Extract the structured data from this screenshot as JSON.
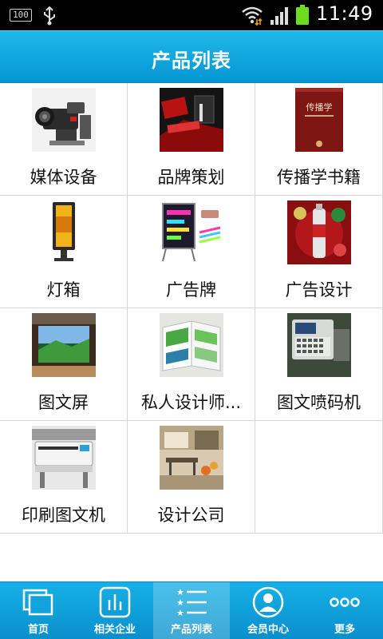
{
  "status_bar": {
    "battery_small_text": "100",
    "time": "11:49"
  },
  "header": {
    "title": "产品列表"
  },
  "products": [
    {
      "label": "媒体设备",
      "icon": "camera-thumbnail"
    },
    {
      "label": "品牌策划",
      "icon": "brand-thumbnail"
    },
    {
      "label": "传播学书籍",
      "icon": "book-thumbnail",
      "book_title": "传播学"
    },
    {
      "label": "灯箱",
      "icon": "lightbox-thumbnail"
    },
    {
      "label": "广告牌",
      "icon": "billboard-thumbnail"
    },
    {
      "label": "广告设计",
      "icon": "ad-design-thumbnail"
    },
    {
      "label": "图文屏",
      "icon": "screen-thumbnail"
    },
    {
      "label": "私人设计师...",
      "icon": "brochure-thumbnail"
    },
    {
      "label": "图文喷码机",
      "icon": "inkjet-thumbnail"
    },
    {
      "label": "印刷图文机",
      "icon": "printer-thumbnail"
    },
    {
      "label": "设计公司",
      "icon": "office-thumbnail"
    }
  ],
  "tabbar": {
    "tabs": [
      {
        "label": "首页",
        "icon": "home-icon",
        "active": false
      },
      {
        "label": "相关企业",
        "icon": "chart-icon",
        "active": false
      },
      {
        "label": "产品列表",
        "icon": "list-icon",
        "active": true
      },
      {
        "label": "会员中心",
        "icon": "user-icon",
        "active": false
      },
      {
        "label": "更多",
        "icon": "more-icon",
        "active": false
      }
    ]
  },
  "colors": {
    "header": "#0ba6df",
    "tabbar": "#0a9fd9",
    "grid_line": "#d4d4d4"
  }
}
